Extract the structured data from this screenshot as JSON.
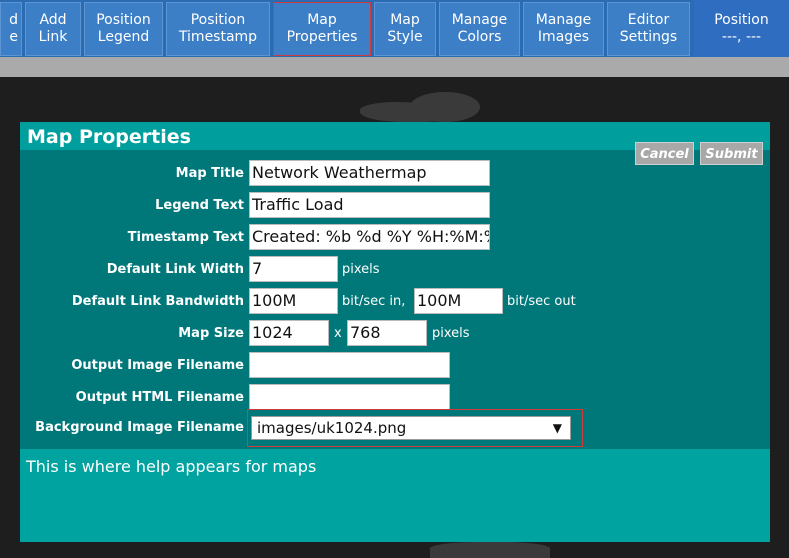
{
  "toolbar": {
    "buttons": [
      {
        "line1": "d",
        "line2": "e"
      },
      {
        "line1": "Add",
        "line2": "Link"
      },
      {
        "line1": "Position",
        "line2": "Legend"
      },
      {
        "line1": "Position",
        "line2": "Timestamp"
      },
      {
        "line1": "Map",
        "line2": "Properties"
      },
      {
        "line1": "Map",
        "line2": "Style"
      },
      {
        "line1": "Manage",
        "line2": "Colors"
      },
      {
        "line1": "Manage",
        "line2": "Images"
      },
      {
        "line1": "Editor",
        "line2": "Settings"
      }
    ],
    "position": {
      "line1": "Position",
      "line2": "---, ---"
    }
  },
  "dialog": {
    "title": "Map Properties",
    "cancel_label": "Cancel",
    "submit_label": "Submit",
    "fields": {
      "map_title": {
        "label": "Map Title",
        "value": "Network Weathermap"
      },
      "legend_text": {
        "label": "Legend Text",
        "value": "Traffic Load"
      },
      "timestamp_text": {
        "label": "Timestamp Text",
        "value": "Created: %b %d %Y %H:%M:%"
      },
      "link_width": {
        "label": "Default Link Width",
        "value": "7",
        "unit": "pixels"
      },
      "link_bandwidth": {
        "label": "Default Link Bandwidth",
        "in_value": "100M",
        "in_unit": "bit/sec in,",
        "out_value": "100M",
        "out_unit": "bit/sec out"
      },
      "map_size": {
        "label": "Map Size",
        "width": "1024",
        "separator": "x",
        "height": "768",
        "unit": "pixels"
      },
      "output_image": {
        "label": "Output Image Filename",
        "value": ""
      },
      "output_html": {
        "label": "Output HTML Filename",
        "value": ""
      },
      "background_image": {
        "label": "Background Image Filename",
        "value": "images/uk1024.png"
      }
    },
    "help_text": "This is where help appears for maps"
  },
  "colors": {
    "toolbar": "#2b6bb1",
    "dialog": "#00787a",
    "dialog_title": "#009e9c",
    "active_border": "#d23b3b"
  }
}
